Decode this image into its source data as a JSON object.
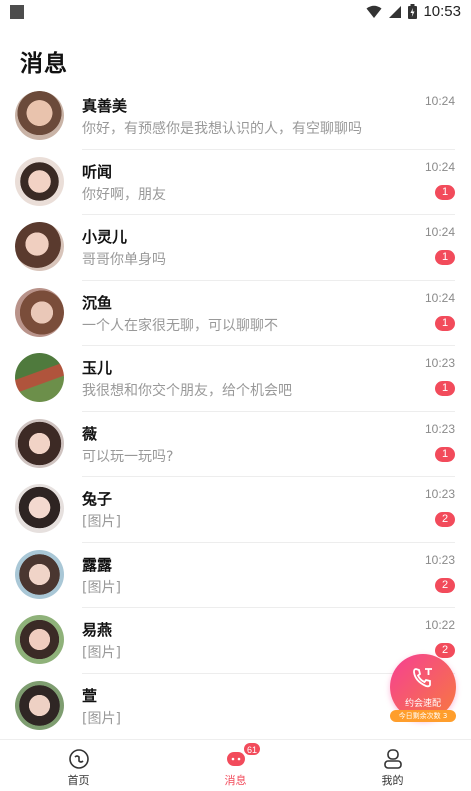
{
  "status_bar": {
    "time": "10:53"
  },
  "header": {
    "title": "消息"
  },
  "messages": [
    {
      "name": "真善美",
      "preview": "你好，有预感你是我想认识的人，有空聊聊吗",
      "time": "10:24",
      "unread": ""
    },
    {
      "name": "听闻",
      "preview": "你好啊，朋友",
      "time": "10:24",
      "unread": "1"
    },
    {
      "name": "小灵儿",
      "preview": "哥哥你单身吗",
      "time": "10:24",
      "unread": "1"
    },
    {
      "name": "沉鱼",
      "preview": "一个人在家很无聊，可以聊聊不",
      "time": "10:24",
      "unread": "1"
    },
    {
      "name": "玉儿",
      "preview": "我很想和你交个朋友，给个机会吧",
      "time": "10:23",
      "unread": "1"
    },
    {
      "name": "薇",
      "preview": "可以玩一玩吗?",
      "time": "10:23",
      "unread": "1"
    },
    {
      "name": "兔子",
      "preview": "[图片]",
      "time": "10:23",
      "unread": "2"
    },
    {
      "name": "露露",
      "preview": "[图片]",
      "time": "10:23",
      "unread": "2"
    },
    {
      "name": "易燕",
      "preview": "[图片]",
      "time": "10:22",
      "unread": "2"
    },
    {
      "name": "萱",
      "preview": "[图片]",
      "time": "",
      "unread": ""
    }
  ],
  "fab": {
    "label": "约会速配",
    "pill": "今日剩余次数 3",
    "icon": "phone-call-icon"
  },
  "bottom_nav": {
    "items": [
      {
        "label": "首页",
        "icon": "home-icon"
      },
      {
        "label": "消息",
        "icon": "message-icon",
        "badge": "61"
      },
      {
        "label": "我的",
        "icon": "profile-icon"
      }
    ]
  },
  "colors": {
    "accent": "#f24b5b",
    "fab_start": "#f63f94",
    "fab_end": "#f77a3e",
    "pill": "#ff9e2c"
  }
}
